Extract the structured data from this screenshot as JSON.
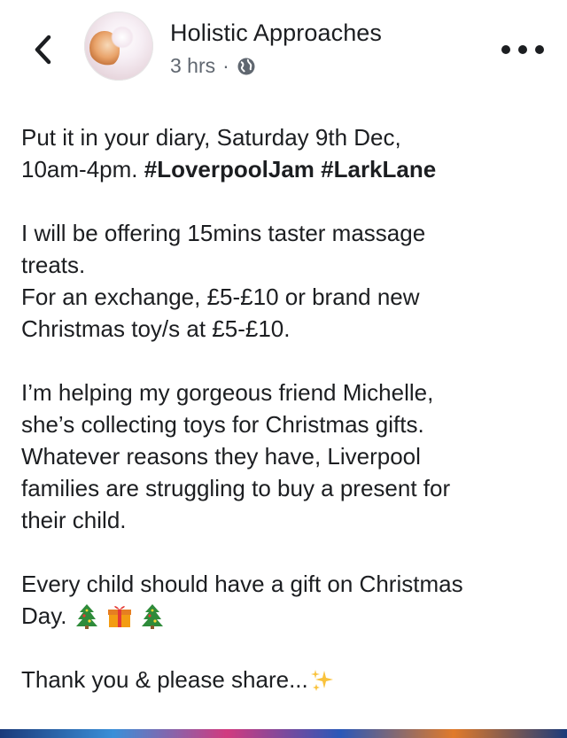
{
  "header": {
    "page_name": "Holistic Approaches",
    "time": "3 hrs",
    "separator": "·",
    "audience_icon": "globe-icon",
    "back_icon": "chevron-left-icon",
    "more_icon": "more-horizontal-icon"
  },
  "post": {
    "p1_line1": "Put it in your diary, Saturday 9th Dec,",
    "p1_line2_text": "10am-4pm. ",
    "hashtag1": "#LoverpoolJam",
    "hashtag2": "#LarkLane",
    "p2_line1": "I will be offering 15mins taster massage",
    "p2_line2": "treats.",
    "p2_line3": "For an exchange, £5-£10 or brand new",
    "p2_line4": "Christmas toy/s at £5-£10.",
    "p3_line1": "I’m helping my gorgeous friend Michelle,",
    "p3_line2": "she’s collecting toys for Christmas gifts.",
    "p3_line3": "Whatever reasons they have, Liverpool",
    "p3_line4": "families are struggling to buy a present for",
    "p3_line5": "their child.",
    "p4_line1": "Every child should have a gift on Christmas",
    "p4_line2": "Day.",
    "p5_line1": "Thank you & please share..."
  },
  "colors": {
    "text": "#1c1e21",
    "meta": "#606770"
  }
}
